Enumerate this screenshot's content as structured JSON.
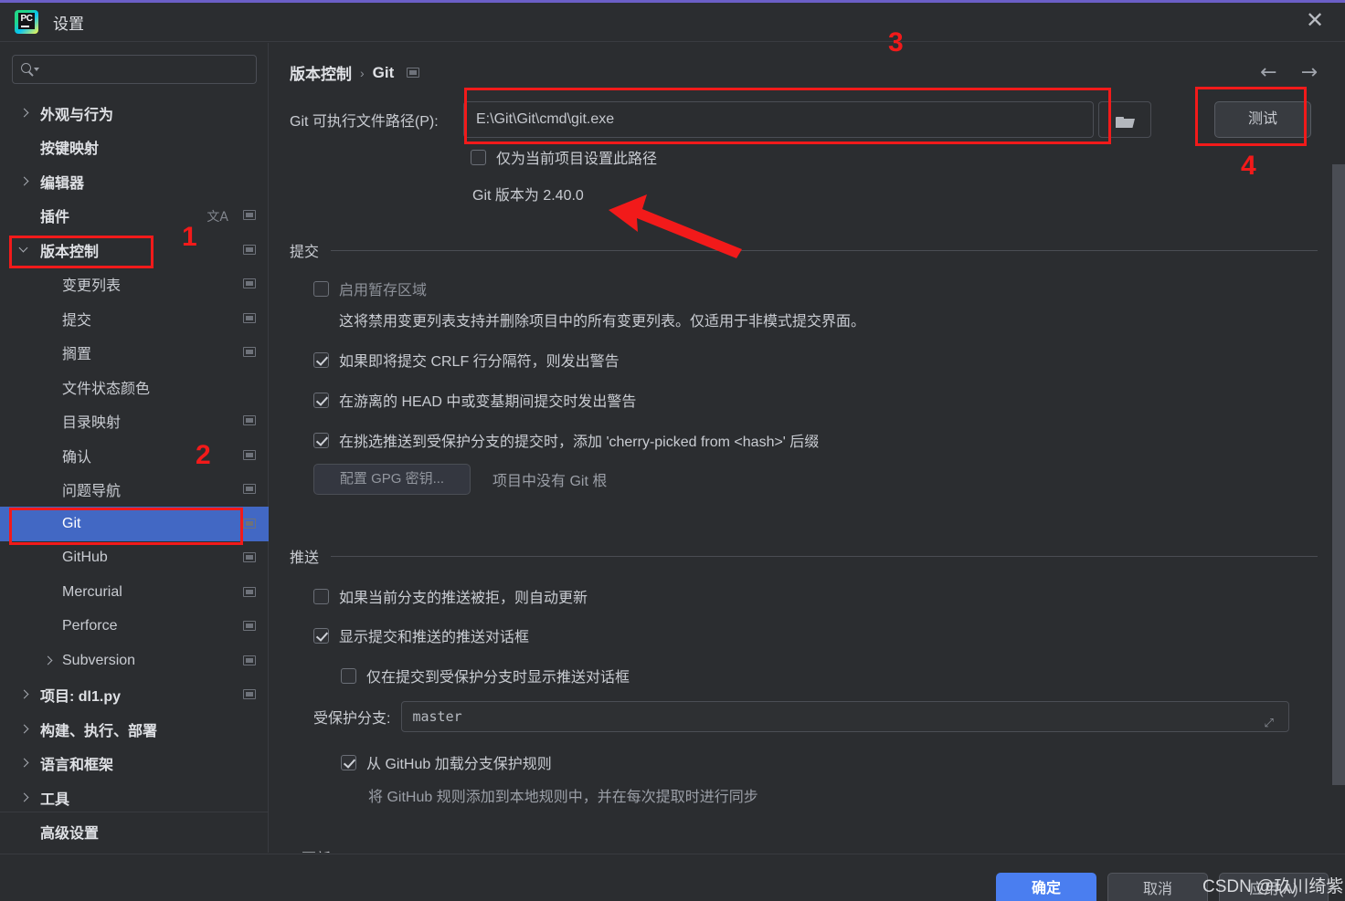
{
  "window": {
    "title": "设置",
    "close_icon": "close-icon",
    "logo": "pycharm-logo"
  },
  "sidebar": {
    "search": {
      "placeholder": "",
      "value": "",
      "icon": "search-icon"
    },
    "items": [
      {
        "label": "外观与行为",
        "level": 0,
        "chevron": "right",
        "bold": true,
        "win_icon": false,
        "selected": false
      },
      {
        "label": "按键映射",
        "level": 0,
        "chevron": "",
        "bold": true,
        "win_icon": false,
        "selected": false
      },
      {
        "label": "编辑器",
        "level": 0,
        "chevron": "right",
        "bold": true,
        "win_icon": false,
        "selected": false
      },
      {
        "label": "插件",
        "level": 0,
        "chevron": "",
        "bold": true,
        "win_icon": true,
        "selected": false,
        "translate_icon": true
      },
      {
        "label": "版本控制",
        "level": 0,
        "chevron": "down",
        "bold": true,
        "win_icon": true,
        "selected": false
      },
      {
        "label": "变更列表",
        "level": 1,
        "chevron": "",
        "bold": false,
        "win_icon": true,
        "selected": false
      },
      {
        "label": "提交",
        "level": 1,
        "chevron": "",
        "bold": false,
        "win_icon": true,
        "selected": false
      },
      {
        "label": "搁置",
        "level": 1,
        "chevron": "",
        "bold": false,
        "win_icon": true,
        "selected": false
      },
      {
        "label": "文件状态颜色",
        "level": 1,
        "chevron": "",
        "bold": false,
        "win_icon": false,
        "selected": false
      },
      {
        "label": "目录映射",
        "level": 1,
        "chevron": "",
        "bold": false,
        "win_icon": true,
        "selected": false
      },
      {
        "label": "确认",
        "level": 1,
        "chevron": "",
        "bold": false,
        "win_icon": true,
        "selected": false
      },
      {
        "label": "问题导航",
        "level": 1,
        "chevron": "",
        "bold": false,
        "win_icon": true,
        "selected": false
      },
      {
        "label": "Git",
        "level": 1,
        "chevron": "",
        "bold": false,
        "win_icon": true,
        "selected": true
      },
      {
        "label": "GitHub",
        "level": 1,
        "chevron": "",
        "bold": false,
        "win_icon": true,
        "selected": false
      },
      {
        "label": "Mercurial",
        "level": 1,
        "chevron": "",
        "bold": false,
        "win_icon": true,
        "selected": false
      },
      {
        "label": "Perforce",
        "level": 1,
        "chevron": "",
        "bold": false,
        "win_icon": true,
        "selected": false
      },
      {
        "label": "Subversion",
        "level": 1,
        "chevron": "right",
        "bold": false,
        "win_icon": true,
        "selected": false
      },
      {
        "label": "项目: dl1.py",
        "level": 0,
        "chevron": "right",
        "bold": true,
        "win_icon": true,
        "selected": false
      },
      {
        "label": "构建、执行、部署",
        "level": 0,
        "chevron": "right",
        "bold": true,
        "win_icon": false,
        "selected": false
      },
      {
        "label": "语言和框架",
        "level": 0,
        "chevron": "right",
        "bold": true,
        "win_icon": false,
        "selected": false
      },
      {
        "label": "工具",
        "level": 0,
        "chevron": "right",
        "bold": true,
        "win_icon": false,
        "selected": false
      },
      {
        "label": "高级设置",
        "level": 0,
        "chevron": "",
        "bold": true,
        "win_icon": false,
        "selected": false
      }
    ],
    "help_label": "?"
  },
  "main": {
    "breadcrumb": {
      "parent": "版本控制",
      "separator": "›",
      "current": "Git"
    },
    "nav": {
      "back": "←",
      "forward": "→"
    },
    "path_row": {
      "label": "Git 可执行文件路径(P):",
      "value": "E:\\Git\\Git\\cmd\\git.exe",
      "browse_icon": "folder-icon",
      "test_button": "测试"
    },
    "project_only_checkbox": {
      "label": "仅为当前项目设置此路径",
      "checked": false
    },
    "git_version": "Git 版本为 2.40.0",
    "commit_section": {
      "title": "提交",
      "staging_checkbox": {
        "label": "启用暂存区域",
        "checked": false,
        "disabled": true
      },
      "staging_note": "这将禁用变更列表支持并删除项目中的所有变更列表。仅适用于非模式提交界面。",
      "items": [
        {
          "label": "如果即将提交 CRLF 行分隔符，则发出警告",
          "checked": true
        },
        {
          "label": "在游离的 HEAD 中或变基期间提交时发出警告",
          "checked": true
        },
        {
          "label": "在挑选推送到受保护分支的提交时，添加 'cherry-picked from <hash>' 后缀",
          "checked": true
        }
      ],
      "gpg_button": "配置 GPG 密钥...",
      "gpg_note": "项目中没有 Git 根"
    },
    "push_section": {
      "title": "推送",
      "items": [
        {
          "label": "如果当前分支的推送被拒，则自动更新",
          "checked": false,
          "indent": 0
        },
        {
          "label": "显示提交和推送的推送对话框",
          "checked": true,
          "indent": 0
        },
        {
          "label": "仅在提交到受保护分支时显示推送对话框",
          "checked": false,
          "indent": 1
        }
      ],
      "protected_branch_label": "受保护分支:",
      "protected_branch_value": "master",
      "expand_icon": "expand-icon",
      "github_checkbox": {
        "label": "从 GitHub 加载分支保护规则",
        "checked": true
      },
      "github_note": "将 GitHub 规则添加到本地规则中，并在每次提取时进行同步"
    },
    "update_section": {
      "title": "更新"
    }
  },
  "footer": {
    "ok": "确定",
    "cancel": "取消",
    "apply": "应用(A)",
    "watermark": "CSDN @玖川绮紫"
  },
  "annotations": {
    "numbers": [
      "1",
      "2",
      "3",
      "4"
    ],
    "color": "#f21a1a"
  }
}
